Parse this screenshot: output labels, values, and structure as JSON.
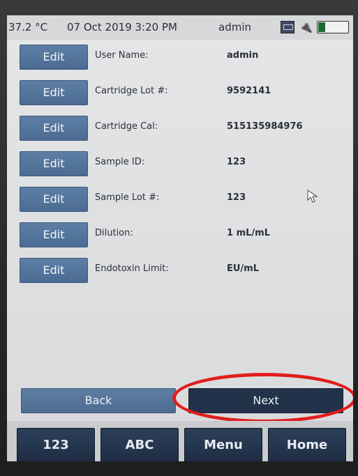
{
  "status_bar": {
    "temperature": "37.2 °C",
    "datetime": "07 Oct 2019 3:20 PM",
    "user": "admin",
    "icons": [
      "network-icon",
      "power-plug-icon",
      "battery-icon"
    ]
  },
  "fields": [
    {
      "edit_label": "Edit",
      "label": "User Name:",
      "value": "admin"
    },
    {
      "edit_label": "Edit",
      "label": "Cartridge Lot #:",
      "value": "9592141"
    },
    {
      "edit_label": "Edit",
      "label": "Cartridge Cal:",
      "value": "515135984976"
    },
    {
      "edit_label": "Edit",
      "label": "Sample ID:",
      "value": "123"
    },
    {
      "edit_label": "Edit",
      "label": "Sample Lot #:",
      "value": "123"
    },
    {
      "edit_label": "Edit",
      "label": "Dilution:",
      "value": "1 mL/mL"
    },
    {
      "edit_label": "Edit",
      "label": "Endotoxin Limit:",
      "value": "EU/mL"
    }
  ],
  "nav": {
    "back_label": "Back",
    "next_label": "Next"
  },
  "bottom_bar": {
    "buttons": [
      "123",
      "ABC",
      "Menu",
      "Home"
    ]
  },
  "colors": {
    "edit_button": "#4f6f96",
    "next_button": "#21324a",
    "highlight": "#e21d1d"
  }
}
